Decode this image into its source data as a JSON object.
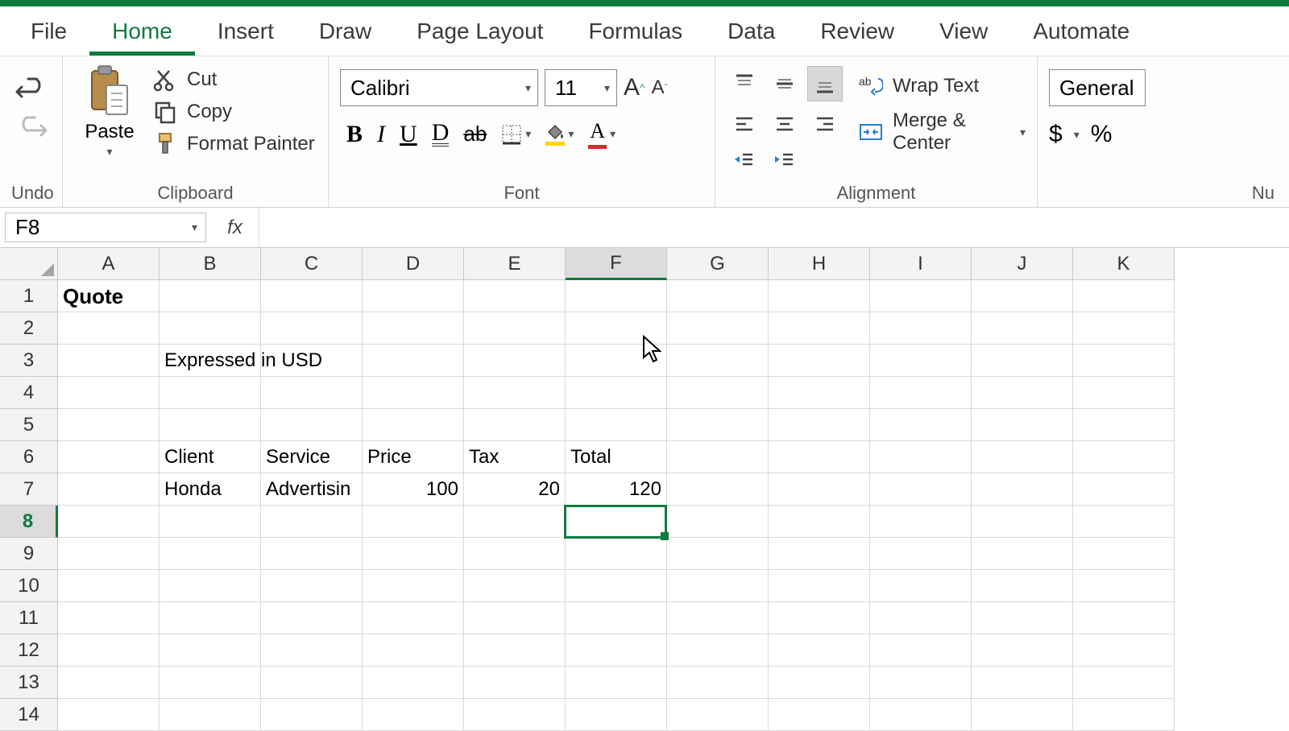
{
  "tabs": {
    "file": "File",
    "home": "Home",
    "insert": "Insert",
    "draw": "Draw",
    "page_layout": "Page Layout",
    "formulas": "Formulas",
    "data": "Data",
    "review": "Review",
    "view": "View",
    "automate": "Automate"
  },
  "ribbon": {
    "undo_label": "Undo",
    "clipboard": {
      "paste": "Paste",
      "cut": "Cut",
      "copy": "Copy",
      "format_painter": "Format Painter",
      "label": "Clipboard"
    },
    "font": {
      "name": "Calibri",
      "size": "11",
      "label": "Font"
    },
    "alignment": {
      "wrap": "Wrap Text",
      "merge": "Merge & Center",
      "label": "Alignment"
    },
    "number": {
      "format": "General",
      "label": "Nu"
    }
  },
  "namebox": "F8",
  "formula": "",
  "columns": [
    "A",
    "B",
    "C",
    "D",
    "E",
    "F",
    "G",
    "H",
    "I",
    "J",
    "K"
  ],
  "selected_col": "F",
  "selected_row": 8,
  "cells": {
    "A1": "Quote",
    "B3": "Expressed in USD",
    "B6": "Client",
    "C6": "Service",
    "D6": "Price",
    "E6": "Tax",
    "F6": "Total",
    "B7": "Honda",
    "C7": "Advertisin",
    "D7": "100",
    "E7": "20",
    "F7": "120"
  }
}
